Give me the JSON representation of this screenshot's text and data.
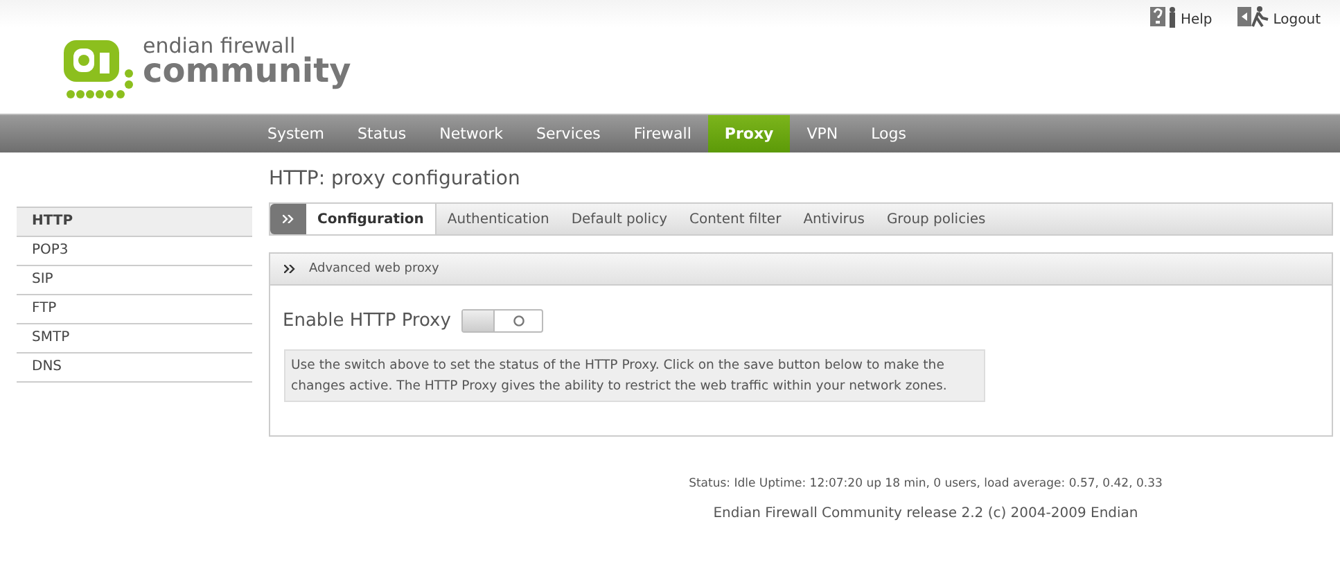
{
  "header": {
    "logo": {
      "line_1": "endian firewall",
      "line_2": "community"
    },
    "links": [
      {
        "kind": "help",
        "label": "Help"
      },
      {
        "kind": "logout",
        "label": "Logout"
      }
    ]
  },
  "nav": [
    {
      "label": "System",
      "selected": false
    },
    {
      "label": "Status",
      "selected": false
    },
    {
      "label": "Network",
      "selected": false
    },
    {
      "label": "Services",
      "selected": false
    },
    {
      "label": "Firewall",
      "selected": false
    },
    {
      "label": "Proxy",
      "selected": true
    },
    {
      "label": "VPN",
      "selected": false
    },
    {
      "label": "Logs",
      "selected": false
    }
  ],
  "page_title": "HTTP: proxy configuration",
  "sidebar": {
    "items": [
      {
        "label": "HTTP",
        "selected": true
      },
      {
        "label": "POP3",
        "selected": false
      },
      {
        "label": "SIP",
        "selected": false
      },
      {
        "label": "FTP",
        "selected": false
      },
      {
        "label": "SMTP",
        "selected": false
      },
      {
        "label": "DNS",
        "selected": false
      }
    ]
  },
  "tabs": [
    {
      "label": "Configuration",
      "selected": true
    },
    {
      "label": "Authentication",
      "selected": false
    },
    {
      "label": "Default policy",
      "selected": false
    },
    {
      "label": "Content filter",
      "selected": false
    },
    {
      "label": "Antivirus",
      "selected": false
    },
    {
      "label": "Group policies",
      "selected": false
    }
  ],
  "panel": {
    "title": "Advanced web proxy",
    "toggle": {
      "label": "Enable HTTP Proxy",
      "on": false
    },
    "info": "Use the switch above to set the status of the HTTP Proxy. Click on the save button below to make the changes active. The HTTP Proxy gives the ability to restrict the web traffic within your network zones."
  },
  "status_line": "Status: Idle Uptime: 12:07:20 up 18 min, 0 users, load average: 0.57, 0.42, 0.33",
  "footer": "Endian Firewall Community release 2.2 (c) 2004-2009 Endian"
}
